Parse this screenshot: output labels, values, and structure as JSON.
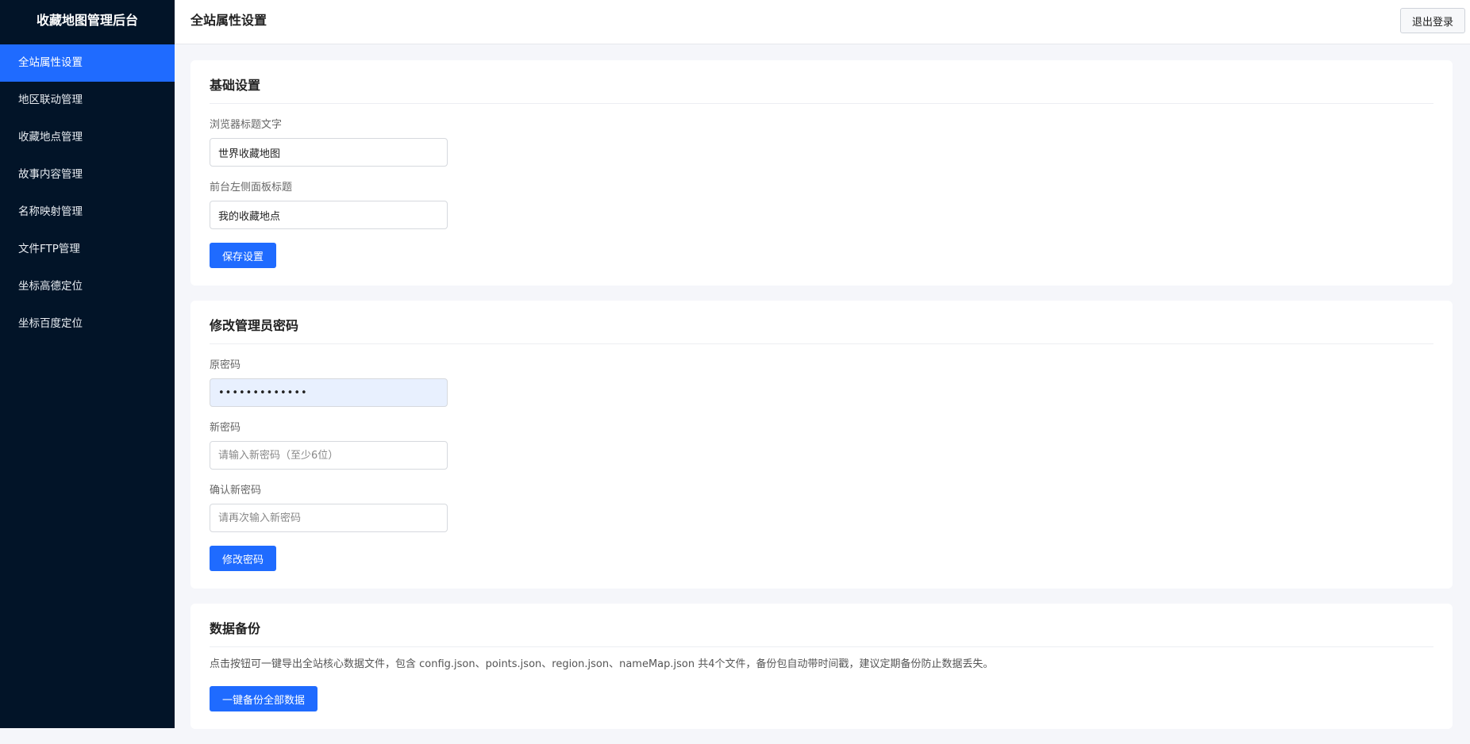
{
  "sidebar": {
    "title": "收藏地图管理后台",
    "items": [
      {
        "label": "全站属性设置",
        "active": true
      },
      {
        "label": "地区联动管理",
        "active": false
      },
      {
        "label": "收藏地点管理",
        "active": false
      },
      {
        "label": "故事内容管理",
        "active": false
      },
      {
        "label": "名称映射管理",
        "active": false
      },
      {
        "label": "文件FTP管理",
        "active": false
      },
      {
        "label": "坐标高德定位",
        "active": false
      },
      {
        "label": "坐标百度定位",
        "active": false
      }
    ]
  },
  "header": {
    "title": "全站属性设置",
    "logout_label": "退出登录"
  },
  "basic_settings": {
    "title": "基础设置",
    "browser_title_label": "浏览器标题文字",
    "browser_title_value": "世界收藏地图",
    "panel_title_label": "前台左侧面板标题",
    "panel_title_value": "我的收藏地点",
    "save_label": "保存设置"
  },
  "password": {
    "title": "修改管理员密码",
    "old_label": "原密码",
    "old_value": "•••••••••••••",
    "new_label": "新密码",
    "new_placeholder": "请输入新密码（至少6位）",
    "confirm_label": "确认新密码",
    "confirm_placeholder": "请再次输入新密码",
    "submit_label": "修改密码"
  },
  "backup": {
    "title": "数据备份",
    "description": "点击按钮可一键导出全站核心数据文件，包含 config.json、points.json、region.json、nameMap.json 共4个文件，备份包自动带时间戳，建议定期备份防止数据丢失。",
    "button_label": "一键备份全部数据"
  },
  "colors": {
    "sidebar_bg": "#021428",
    "accent": "#1f6bff",
    "page_bg": "#f5f6fa"
  }
}
